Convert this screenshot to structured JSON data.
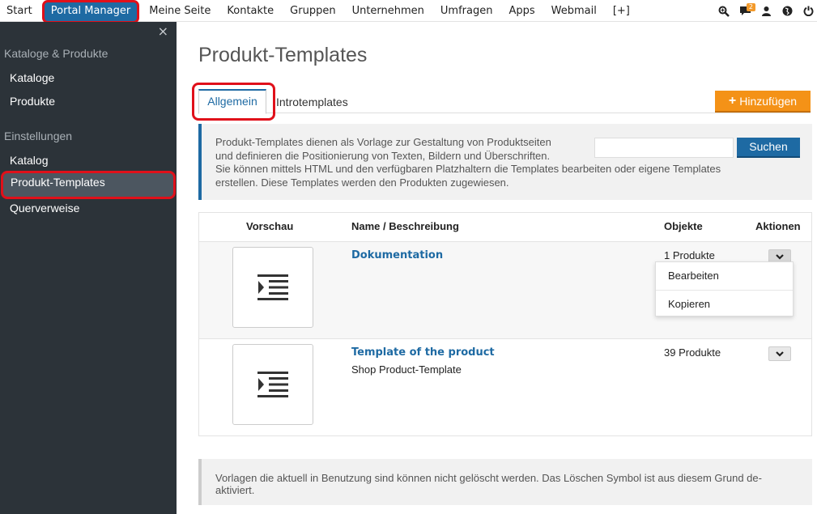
{
  "topnav": {
    "items": [
      "Start",
      "Portal Manager",
      "Meine Seite",
      "Kontakte",
      "Gruppen",
      "Unternehmen",
      "Umfragen",
      "Apps",
      "Webmail",
      "[+]"
    ],
    "notification_count": "2",
    "icons": [
      "search-zoom-icon",
      "chat-icon",
      "user-icon",
      "globe-icon",
      "power-icon"
    ]
  },
  "sidebar": {
    "close_glyph": "×",
    "section1": "Kataloge & Produkte",
    "section1_items": [
      "Kataloge",
      "Produkte"
    ],
    "section2": "Einstellungen",
    "section2_items": [
      "Katalog",
      "Produkt-Templates",
      "Querverweise"
    ]
  },
  "page": {
    "title": "Produkt-Templates",
    "tabs": [
      "Allgemein",
      "Introtemplates"
    ],
    "add_button": "Hinzufügen",
    "info_lines": [
      "Produkt-Templates dienen als Vorlage zur Gestaltung von Produktseiten",
      "und definieren die Positionierung von Texten, Bildern und Überschriften.",
      "Sie können mittels HTML und den verfügbaren Platzhaltern die Templates bearbeiten oder eigene Templates",
      "erstellen. Diese Templates werden den Produkten zugewiesen."
    ],
    "search_placeholder": "",
    "search_button": "Suchen",
    "note": "Vorlagen die aktuell in Benutzung sind können nicht gelöscht werden. Das Löschen Symbol ist aus diesem Grund de-aktiviert."
  },
  "table": {
    "headers": [
      "Vorschau",
      "Name / Beschreibung",
      "Objekte",
      "Aktionen"
    ],
    "rows": [
      {
        "name": "Dokumentation",
        "description": "",
        "objects": "1 Produkte"
      },
      {
        "name": "Template of the product",
        "description": "Shop Product-Template",
        "objects": "39 Produkte"
      }
    ],
    "dropdown_items": [
      "Bearbeiten",
      "Kopieren"
    ]
  },
  "colors": {
    "accent": "#1e6aa3",
    "orange": "#f49217",
    "highlight": "#e0101a",
    "sidebar": "#2c3339"
  }
}
